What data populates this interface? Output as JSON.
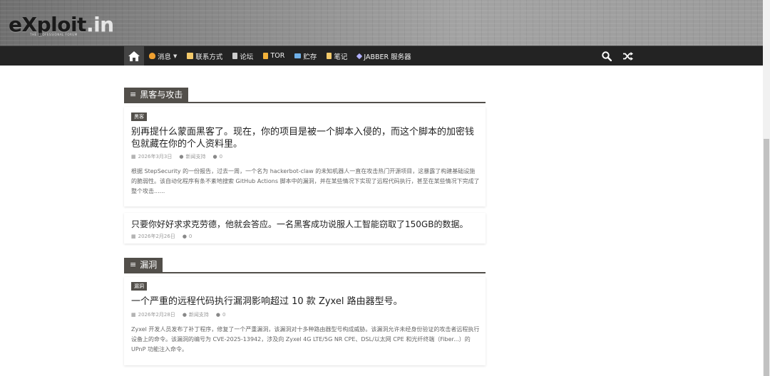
{
  "header": {
    "logo_main": "eXploit",
    "logo_tld": ".in",
    "logo_tagline": "THE PROFESSIONAL FORUM"
  },
  "nav": {
    "items": [
      {
        "label": "消息",
        "icon": "flame-icon",
        "color": "#f0a030",
        "has_dropdown": true
      },
      {
        "label": "联系方式",
        "icon": "notepad-icon",
        "color": "#f3c96a"
      },
      {
        "label": "论坛",
        "icon": "trash-icon",
        "color": "#cccccc"
      },
      {
        "label": "TOR",
        "icon": "lock-icon",
        "color": "#f3b23a"
      },
      {
        "label": "贮存",
        "icon": "folder-icon",
        "color": "#6fb0e8"
      },
      {
        "label": "笔记",
        "icon": "notebook-icon",
        "color": "#f3c96a"
      },
      {
        "label": "JABBER 服务器",
        "icon": "rocket-icon",
        "color": "#b0b0ff"
      }
    ]
  },
  "sections": [
    {
      "title": "黑客与攻击",
      "posts": [
        {
          "category": "黑客",
          "title": "别再提什么蒙面黑客了。现在，你的项目是被一个脚本入侵的，而这个脚本的加密钱包就藏在你的个人资料里。",
          "date": "2026年3月3日",
          "author": "新闻支持",
          "comments": "0",
          "excerpt": "根据 StepSecurity 的一份报告，过去一周，一个名为 hackerbot-claw 的未知机器人一直在攻击热门开源项目，这暴露了构建基础设施的脆弱性。该自动化程序有条不紊地搜索 GitHub Actions 脚本中的漏洞，并在某些情况下实现了远程代码执行，甚至在某些情况下完成了整个攻击......"
        },
        {
          "title": "只要你好好求求克劳德，他就会答应。一名黑客成功说服人工智能窃取了150GB的数据。",
          "date": "2026年2月26日",
          "comments": "0"
        }
      ]
    },
    {
      "title": "漏洞",
      "posts": [
        {
          "category": "漏洞",
          "title": "一个严重的远程代码执行漏洞影响超过 10 款 Zyxel 路由器型号。",
          "date": "2026年2月28日",
          "author": "新闻支持",
          "comments": "0",
          "excerpt": "Zyxel 开发人员发布了补丁程序，修复了一个严重漏洞，该漏洞对十多种路由器型号构成威胁。该漏洞允许未经身份验证的攻击者远程执行设备上的命令。该漏洞的编号为 CVE-2025-13942，涉及向 Zyxel 4G LTE/5G NR CPE、DSL/以太网 CPE 和光纤终端（Fiber...）的 UPnP 功能注入命令。"
        }
      ]
    }
  ],
  "colors": {
    "navbar_bg": "#232323",
    "accent": "#524f4a"
  }
}
